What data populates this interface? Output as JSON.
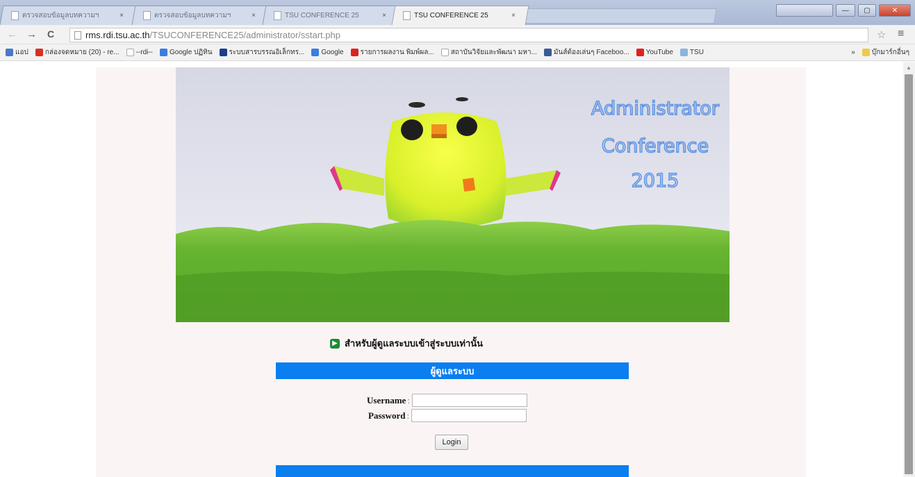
{
  "browser": {
    "tabs": [
      {
        "label": "ตรวจสอบข้อมูลบทความฯ",
        "active": false
      },
      {
        "label": "ตรวจสอบข้อมูลบทความฯ",
        "active": false
      },
      {
        "label": "TSU CONFERENCE 25",
        "active": false
      },
      {
        "label": "TSU CONFERENCE 25",
        "active": true
      }
    ],
    "tab_close": "×",
    "url_host": "rms.rdi.tsu.ac.th",
    "url_path": "/TSUCONFERENCE25/administrator/sstart.php",
    "back": "←",
    "forward": "→",
    "reload": "C",
    "star": "☆",
    "menu": "≡",
    "window_min": "—",
    "window_max": "▢",
    "window_close": "✕",
    "bookmarks": [
      {
        "label": "แอป",
        "color": "#4a78c8"
      },
      {
        "label": "กล่องจดหมาย (20) - re...",
        "color": "#d93025"
      },
      {
        "label": "--rdi--",
        "color": "#bbbbbb"
      },
      {
        "label": "Google ปฏิทิน",
        "color": "#3b7de0"
      },
      {
        "label": "ระบบสารบรรณอิเล็กทร...",
        "color": "#1e3c8c"
      },
      {
        "label": "Google",
        "color": "#3b7de0"
      },
      {
        "label": "รายการผลงาน พิมพ์ผล...",
        "color": "#e02020"
      },
      {
        "label": "สถาบันวิจัยและพัฒนา มหา...",
        "color": "#bbbbbb"
      },
      {
        "label": "มันส์ต้องเล่นๆ Faceboo...",
        "color": "#3b5998"
      },
      {
        "label": "YouTube",
        "color": "#e02020"
      },
      {
        "label": "TSU",
        "color": "#8ab4e0"
      }
    ],
    "bookmarks_more": "»",
    "other_bookmarks": "บุ๊กมาร์กอื่นๆ"
  },
  "banner": {
    "line1": "Administrator",
    "line2": "Conference",
    "line3": "2015"
  },
  "notice": {
    "icon": "arrow-right-icon",
    "text": "สำหรับผู้ดูแลระบบเข้าสู่ระบบเท่านั้น"
  },
  "form": {
    "header": "ผู้ดูแลระบบ",
    "username_label": "Username",
    "password_label": "Password",
    "colon": ":",
    "username_value": "",
    "password_value": "",
    "login_label": "Login"
  },
  "colors": {
    "accent_blue": "#0b7ef0",
    "panel_bg": "#faf4f5",
    "banner_text": "#6fa0e6"
  }
}
